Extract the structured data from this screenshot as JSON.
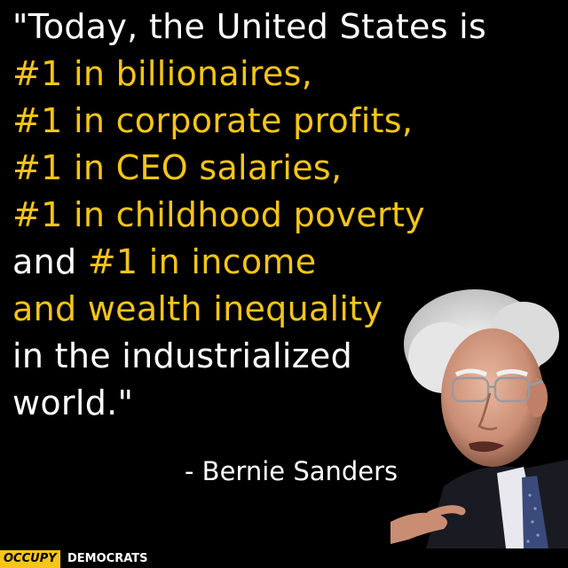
{
  "quote": {
    "lines": [
      [
        {
          "text": "\"Today, the United States is",
          "color": "white"
        }
      ],
      [
        {
          "text": "#1 in billionaires,",
          "color": "yellow"
        }
      ],
      [
        {
          "text": "#1 in corporate profits,",
          "color": "yellow"
        }
      ],
      [
        {
          "text": "#1 in CEO salaries,",
          "color": "yellow"
        }
      ],
      [
        {
          "text": "#1 in childhood poverty",
          "color": "yellow"
        }
      ],
      [
        {
          "text": "and ",
          "color": "white"
        },
        {
          "text": "#1 in income",
          "color": "yellow"
        }
      ],
      [
        {
          "text": "and wealth inequality",
          "color": "yellow"
        }
      ],
      [
        {
          "text": "in the industrialized",
          "color": "white"
        }
      ],
      [
        {
          "text": "world.\"",
          "color": "white"
        }
      ]
    ]
  },
  "attribution": "- Bernie Sanders",
  "footer": {
    "occupy": "OCCUPY",
    "democrats": "DEMOCRATS"
  },
  "colors": {
    "background": "#000000",
    "white": "#ffffff",
    "yellow": "#f5c518"
  },
  "icons": {
    "photo": "speaker-portrait-photo"
  }
}
